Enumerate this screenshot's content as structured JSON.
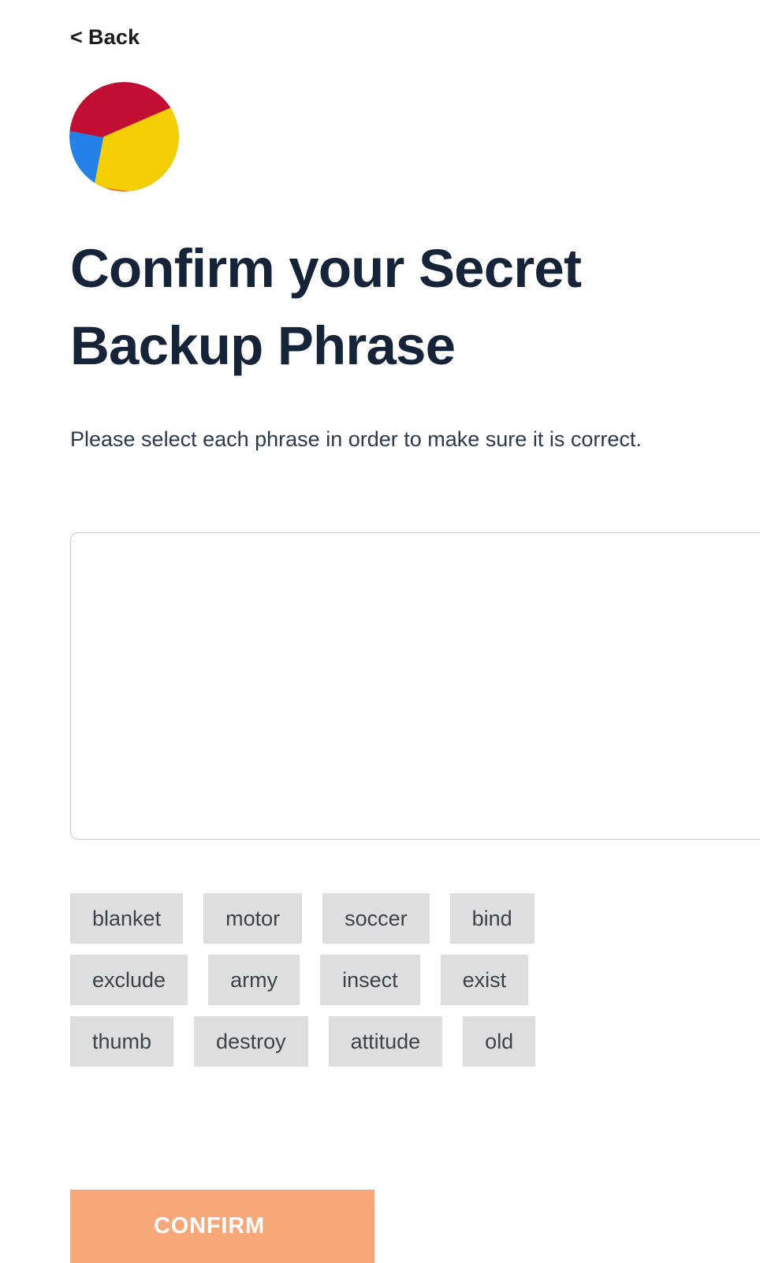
{
  "nav": {
    "back_label": "Back",
    "back_chevron": "<",
    "back_icon": "chevron-left-icon"
  },
  "brand": {
    "logo_icon": "circular-color-wheel-logo",
    "colors": {
      "crimson": "#C20E33",
      "yellow": "#F3CE04",
      "blue": "#2481E8",
      "orange": "#F2662A"
    }
  },
  "header": {
    "title": "Confirm your Secret Backup Phrase",
    "subtitle": "Please select each phrase in order to make sure it is correct."
  },
  "phrase_box": {
    "name": "selected-phrase-area",
    "value": "",
    "placeholder": "",
    "border_color": "#c7c7cc"
  },
  "word_bank": {
    "rows": [
      [
        "blanket",
        "motor",
        "soccer",
        "bind"
      ],
      [
        "exclude",
        "army",
        "insect",
        "exist"
      ],
      [
        "thumb",
        "destroy",
        "attitude",
        "old"
      ]
    ],
    "chip_background": "#dedede",
    "chip_text_color": "#3d4248"
  },
  "actions": {
    "confirm_label": "CONFIRM",
    "confirm_color": "#f8a878",
    "confirm_text_color": "#ffffff"
  }
}
